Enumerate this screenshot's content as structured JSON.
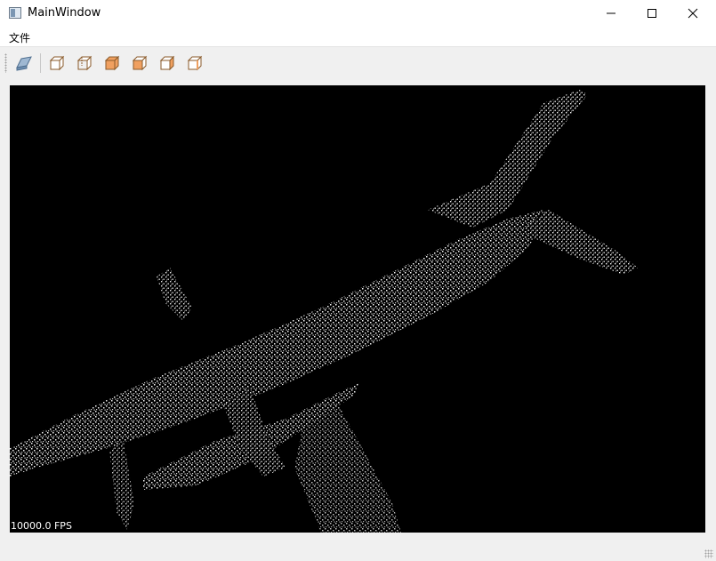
{
  "window": {
    "title": "MainWindow"
  },
  "menu": {
    "items": [
      {
        "label": "文件"
      }
    ]
  },
  "toolbar": {
    "buttons": [
      {
        "name": "open-file-button",
        "icon": "open-file-icon"
      },
      {
        "name": "view-front-button",
        "icon": "cube-front-icon"
      },
      {
        "name": "view-back-button",
        "icon": "cube-back-icon"
      },
      {
        "name": "view-top-button",
        "icon": "cube-top-icon"
      },
      {
        "name": "view-bottom-button",
        "icon": "cube-bottom-icon"
      },
      {
        "name": "view-left-button",
        "icon": "cube-left-icon"
      },
      {
        "name": "view-right-button",
        "icon": "cube-right-icon"
      }
    ],
    "accent_color": "#f0a060"
  },
  "viewport": {
    "fps_text": "10000.0 FPS",
    "background_color": "#000000",
    "point_color": "#ffffff"
  }
}
